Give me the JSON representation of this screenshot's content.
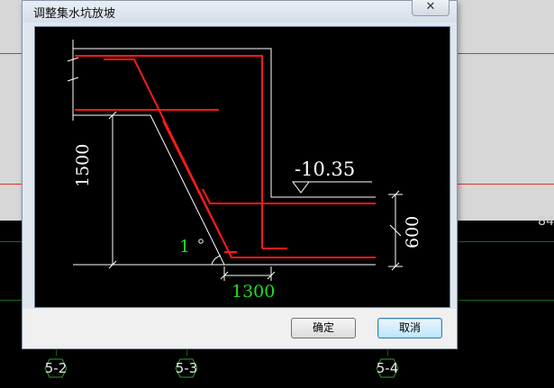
{
  "background": {
    "axis_labels": [
      "5-2",
      "5-3",
      "5-4"
    ],
    "side_number": "84"
  },
  "dialog": {
    "title": "调整集水坑放坡",
    "close_glyph": "✕",
    "ok_label": "确定",
    "cancel_label": "取消"
  },
  "drawing": {
    "elevation_label": "-10.35",
    "height_label": "1500",
    "slope_label": "1",
    "width_label": "1300",
    "depth_label": "600"
  },
  "colors": {
    "rebar": "#ff1a1a",
    "outline": "#ffffff",
    "slope_text": "#22dd22",
    "cad_red_line": "#e23030",
    "cad_green_line": "#1a6a1a"
  }
}
